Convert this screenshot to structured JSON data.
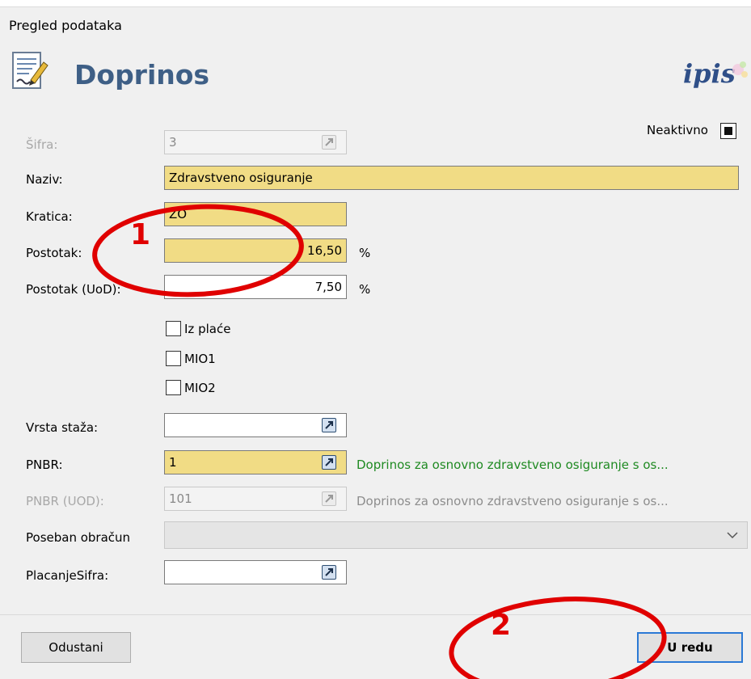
{
  "window": {
    "title": "Pregled podataka"
  },
  "header": {
    "icon": "document-edit-icon",
    "title": "Doprinos",
    "logo_text": "ipis"
  },
  "inactive": {
    "label": "Neaktivno",
    "checked": true
  },
  "fields": {
    "sifra": {
      "label": "Šifra:",
      "value": "3",
      "disabled": true
    },
    "naziv": {
      "label": "Naziv:",
      "value": "Zdravstveno osiguranje"
    },
    "kratica": {
      "label": "Kratica:",
      "value": "ZO"
    },
    "postotak": {
      "label": "Postotak:",
      "value": "16,50",
      "unit": "%"
    },
    "postotak_uod": {
      "label": "Postotak (UoD):",
      "value": "7,50",
      "unit": "%"
    },
    "vrsta_staza": {
      "label": "Vrsta staža:",
      "value": ""
    },
    "pnbr": {
      "label": "PNBR:",
      "value": "1",
      "description": "Doprinos za osnovno zdravstveno osiguranje s os..."
    },
    "pnbr_uod": {
      "label": "PNBR (UOD):",
      "value": "101",
      "description": "Doprinos za osnovno zdravstveno osiguranje s os...",
      "disabled": true
    },
    "poseban_obracun": {
      "label": "Poseban obračun",
      "value": ""
    },
    "placanje_sifra": {
      "label": "PlacanjeSifra:",
      "value": ""
    }
  },
  "checkboxes": [
    {
      "label": "Iz plaće",
      "checked": false
    },
    {
      "label": "MIO1",
      "checked": false
    },
    {
      "label": "MIO2",
      "checked": false
    }
  ],
  "buttons": {
    "cancel": "Odustani",
    "ok": "U redu"
  },
  "annotations": [
    {
      "label": "1"
    },
    {
      "label": "2"
    }
  ],
  "colors": {
    "title": "#3e5f86",
    "required_field": "#f1dc85",
    "description_green": "#1f8a22",
    "annotation_red": "#e00000",
    "default_button_border": "#2b79d5"
  }
}
